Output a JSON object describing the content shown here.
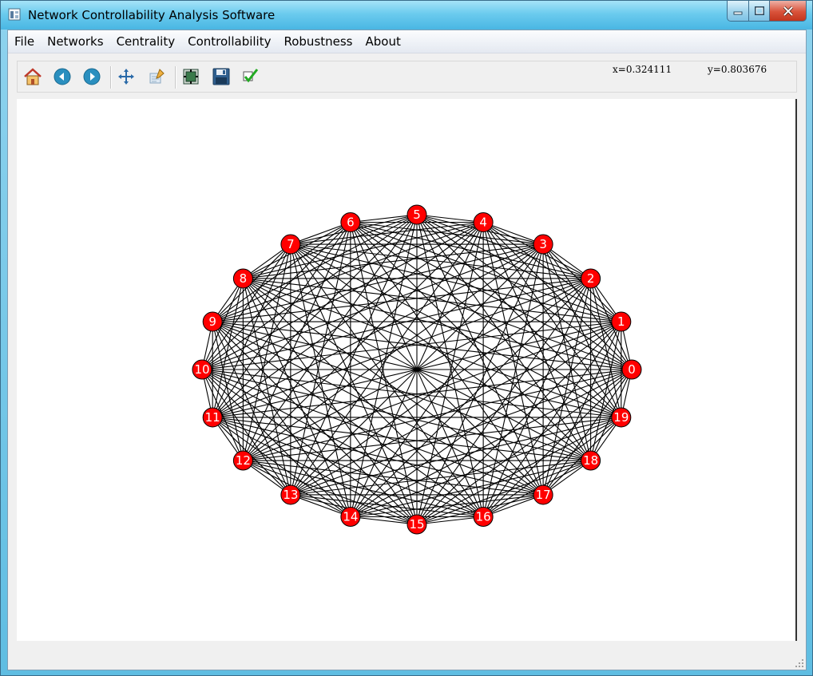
{
  "window": {
    "title": "Network Controllability Analysis Software"
  },
  "menu": {
    "items": [
      "File",
      "Networks",
      "Centrality",
      "Controllability",
      "Robustness",
      "About"
    ]
  },
  "toolbar": {
    "tools": [
      {
        "icon": "home-icon"
      },
      {
        "icon": "back-arrow-icon"
      },
      {
        "icon": "forward-arrow-icon"
      },
      {
        "icon": "pan-icon"
      },
      {
        "icon": "zoom-rect-icon"
      },
      {
        "icon": "configure-subplots-icon"
      },
      {
        "icon": "save-icon"
      },
      {
        "icon": "edit-check-icon"
      }
    ]
  },
  "coords": {
    "x": "x=0.324111",
    "y": "y=0.803676"
  },
  "graph": {
    "layout": "circular",
    "complete": true,
    "node_labels": [
      "0",
      "1",
      "2",
      "3",
      "4",
      "5",
      "6",
      "7",
      "8",
      "9",
      "10",
      "11",
      "12",
      "13",
      "14",
      "15",
      "16",
      "17",
      "18",
      "19"
    ],
    "node_color": "#ff0000",
    "edge_color": "#000000"
  }
}
